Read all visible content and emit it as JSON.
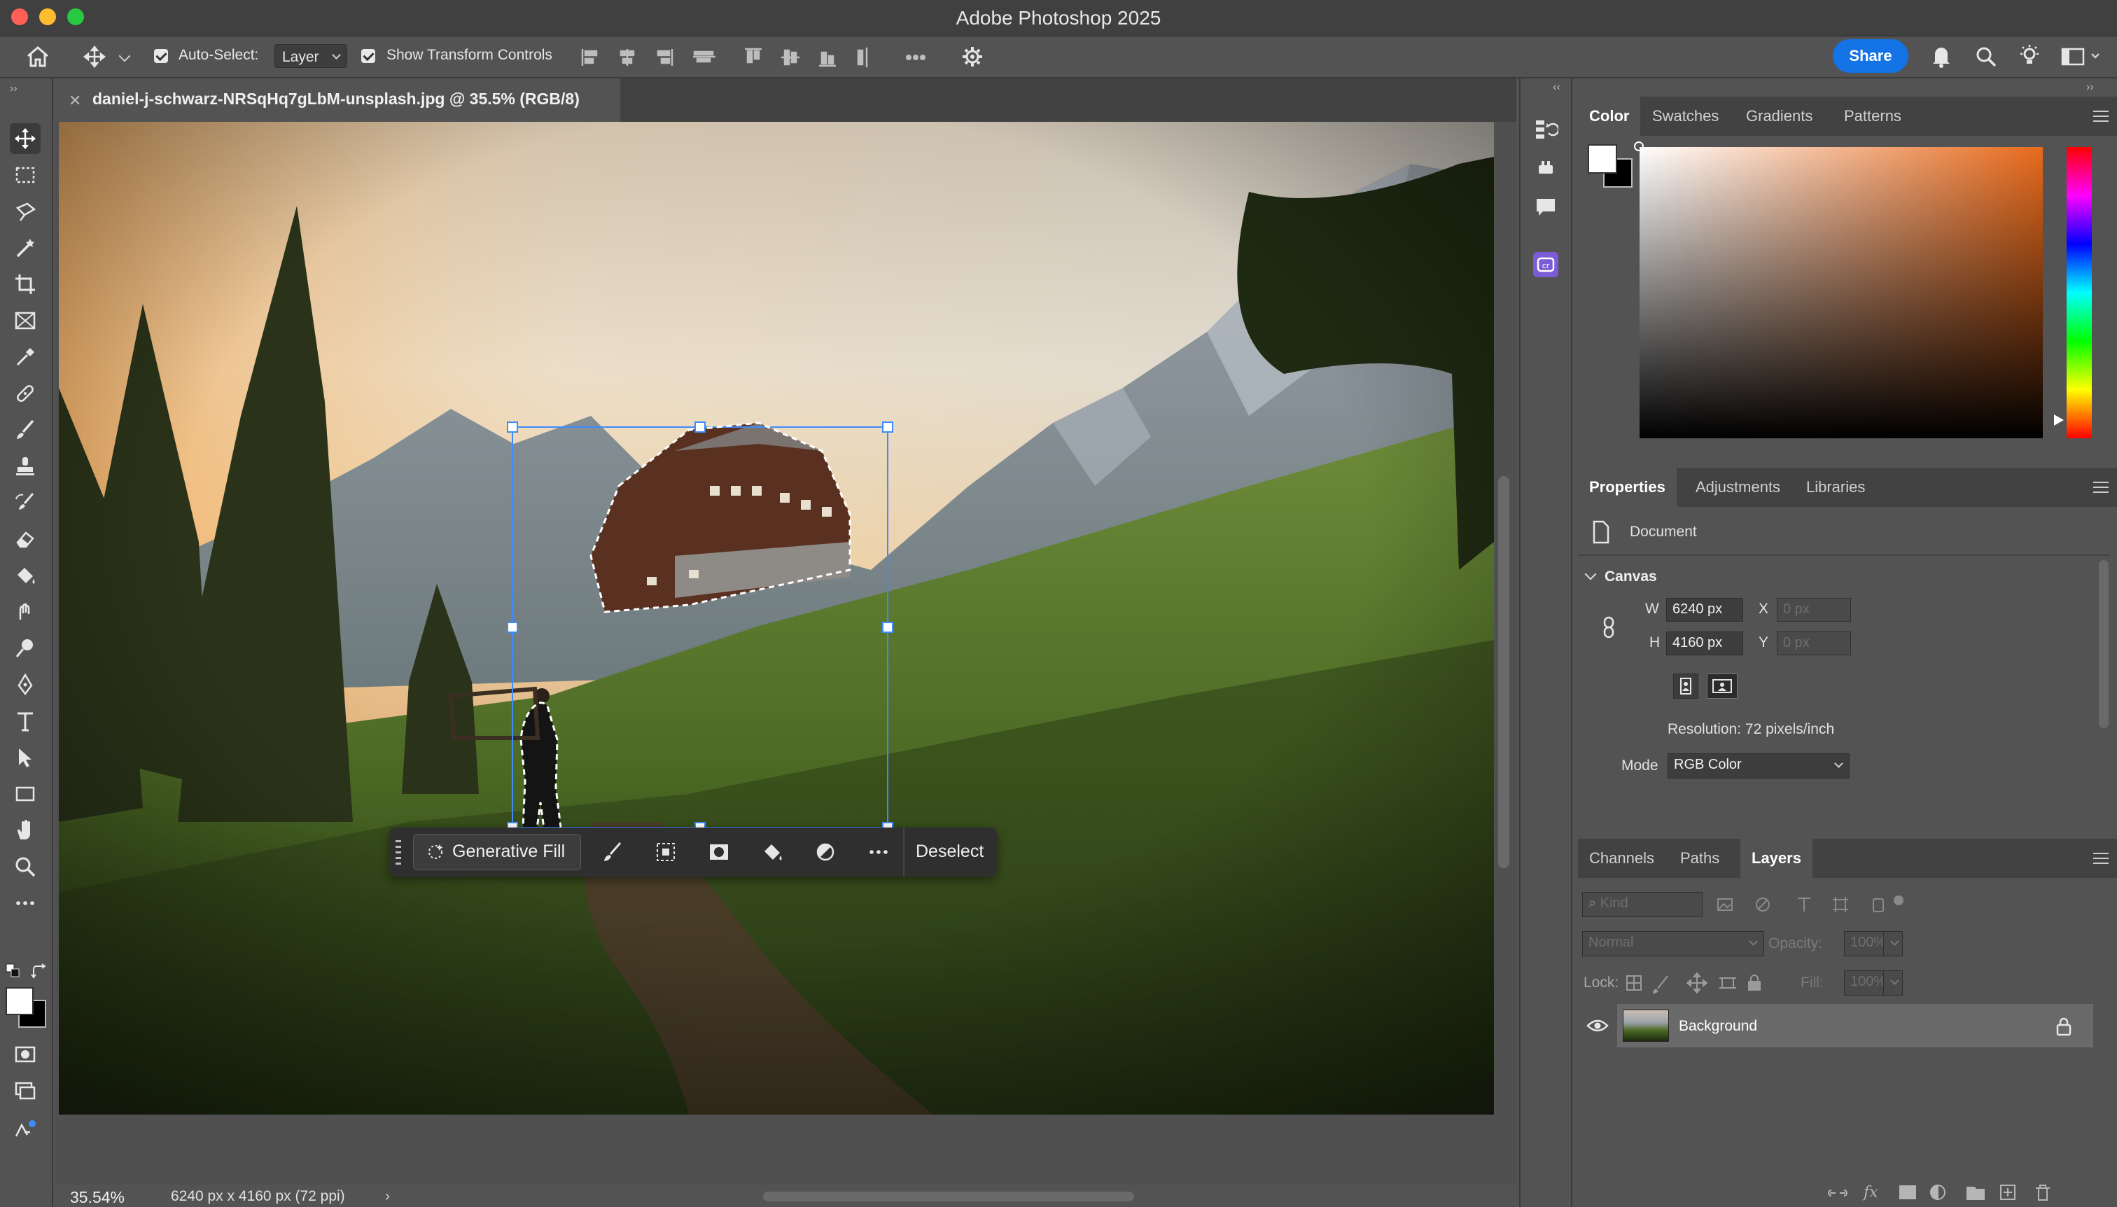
{
  "window": {
    "title": "Adobe Photoshop 2025",
    "colors": {
      "close": "#ff5f57",
      "minimize": "#febc2e",
      "zoom": "#28c840"
    }
  },
  "options_bar": {
    "auto_select_label": "Auto-Select:",
    "auto_select_checked": true,
    "auto_select_value": "Layer",
    "show_transform_label": "Show Transform Controls",
    "show_transform_checked": true,
    "share_label": "Share",
    "accent": "#1473e6"
  },
  "document": {
    "tab_title": "daniel-j-schwarz-NRSqHq7gLbM-unsplash.jpg @ 35.5% (RGB/8)",
    "zoom": "35.54%",
    "size_info": "6240 px x 4160 px (72 ppi)"
  },
  "contextual_taskbar": {
    "generative_fill_label": "Generative Fill",
    "deselect_label": "Deselect"
  },
  "color_panel": {
    "tabs": [
      "Color",
      "Swatches",
      "Gradients",
      "Patterns"
    ],
    "active_tab": "Color",
    "hue_color": "#e86a1c"
  },
  "properties_panel": {
    "tabs": [
      "Properties",
      "Adjustments",
      "Libraries"
    ],
    "active_tab": "Properties",
    "doc_label": "Document",
    "section": "Canvas",
    "w_label": "W",
    "w_value": "6240 px",
    "h_label": "H",
    "h_value": "4160 px",
    "x_label": "X",
    "x_placeholder": "0 px",
    "y_label": "Y",
    "y_placeholder": "0 px",
    "resolution": "Resolution: 72 pixels/inch",
    "mode_label": "Mode",
    "mode_value": "RGB Color"
  },
  "layers_panel": {
    "tabs": [
      "Channels",
      "Paths",
      "Layers"
    ],
    "active_tab": "Layers",
    "kind_placeholder": "Kind",
    "blend_mode": "Normal",
    "opacity_label": "Opacity:",
    "opacity_value": "100%",
    "lock_label": "Lock:",
    "fill_label": "Fill:",
    "fill_value": "100%",
    "layers": [
      {
        "name": "Background",
        "visible": true,
        "locked": true
      }
    ]
  }
}
